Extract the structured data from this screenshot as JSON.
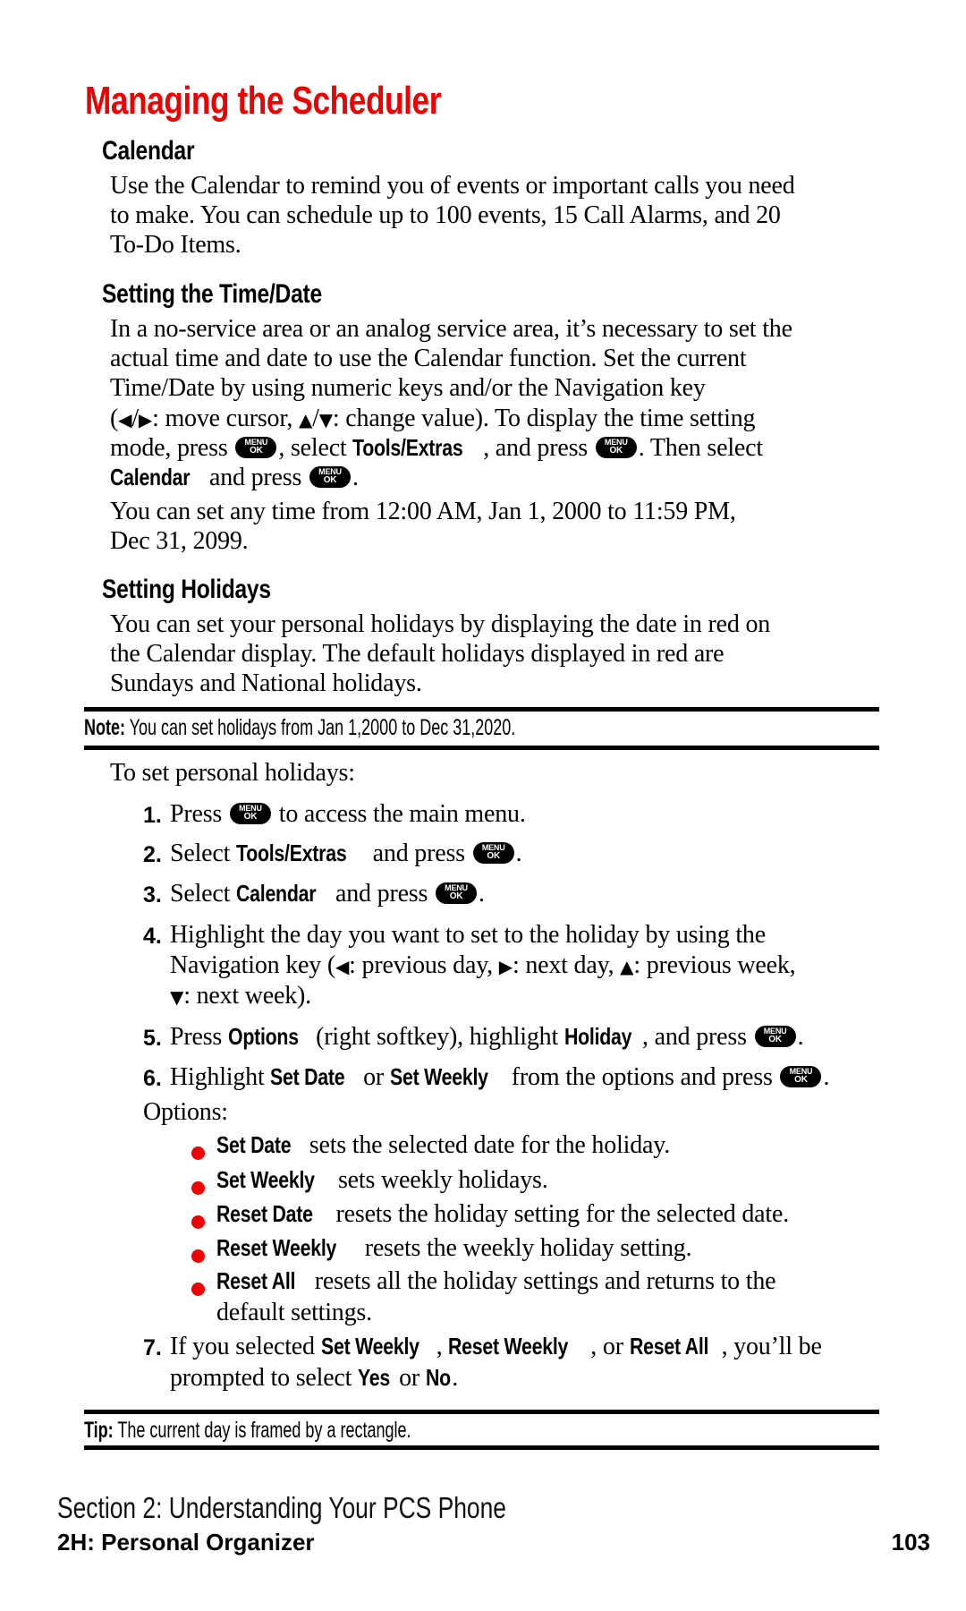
{
  "page": {
    "title": "Managing the Scheduler",
    "accent_color": "#ee0000"
  },
  "key_icon": {
    "line1": "MENU",
    "line2": "OK"
  },
  "calendar": {
    "heading": "Calendar",
    "lines": [
      "Use the Calendar to remind you of events or important calls you need",
      "to make. You can schedule up to 100 events, 15 Call Alarms, and 20",
      "To-Do Items."
    ]
  },
  "time_date": {
    "heading": "Setting the Time/Date",
    "line1": "In a no-service area or an analog service area, it’s necessary to set the",
    "line2": "actual time and date to use the Calendar function. Set the current",
    "line3": "Time/Date by using numeric keys and/or the Navigation key",
    "line4": {
      "open": "(",
      "left_arrow": "◀",
      "slash1": "/",
      "right_arrow": "▶",
      "t1": ": move cursor, ",
      "up_arrow": "▲",
      "slash2": "/",
      "down_arrow": "▼",
      "t2": ": change value). To display the time setting"
    },
    "line5": {
      "t1": "mode, press",
      "t2": ", select ",
      "b1": "Tools/Extras",
      "t3": ", and press",
      "t4": ". Then select"
    },
    "line6": {
      "b1": "Calendar",
      "t1": " and press",
      "t2": "."
    },
    "range_lines": [
      "You can set any time from 12:00 AM, Jan 1, 2000 to 11:59 PM,",
      "Dec 31, 2099."
    ]
  },
  "holidays": {
    "heading": "Setting Holidays",
    "lines": [
      "You can set your personal holidays by displaying the date in red on",
      "the Calendar display. The default holidays displayed in red are",
      "Sundays and National holidays."
    ],
    "note_label": "Note:",
    "note_text": " You can set holidays from Jan 1,2000 to Dec 31,2020.",
    "intro": "To set personal holidays:",
    "steps": [
      {
        "num": "1.",
        "t1": "Press",
        "t2": " to access the main menu."
      },
      {
        "num": "2.",
        "t1": "Select ",
        "b1": "Tools/Extras",
        "t2": " and press",
        "t3": "."
      },
      {
        "num": "3.",
        "t1": "Select ",
        "b1": "Calendar",
        "t2": " and press",
        "t3": "."
      },
      {
        "num": "4.",
        "l1": "Highlight the day you want to set to the holiday by using the",
        "l2a": "Navigation key (",
        "left_arrow": "◀",
        "l2b": ": previous day, ",
        "right_arrow": "▶",
        "l2c": ": next day, ",
        "up_arrow": "▲",
        "l2d": ": previous week,",
        "down_arrow": "▼",
        "l3": ": next week)."
      },
      {
        "num": "5.",
        "t1": "Press ",
        "b1": "Options",
        "t2": " (right softkey), highlight ",
        "b2": "Holiday",
        "t3": ", and press",
        "t4": "."
      },
      {
        "num": "6.",
        "t1": "Highlight ",
        "b1": "Set Date",
        "t2": " or ",
        "b2": "Set Weekly",
        "t3": " from the options and press",
        "t4": "."
      },
      {
        "num": "7.",
        "t1": "If you selected ",
        "b1": "Set Weekly",
        "t2": ", ",
        "b2": "Reset Weekly",
        "t3": ", or ",
        "b3": "Reset All",
        "t4": ", you’ll be",
        "l2a": "prompted to select ",
        "b4": "Yes",
        "l2b": " or ",
        "b5": "No",
        "l2c": "."
      }
    ],
    "options_label": "Options:",
    "options": [
      {
        "name": "Set Date",
        "desc": " sets the selected date for the holiday."
      },
      {
        "name": "Set Weekly",
        "desc": " sets weekly holidays."
      },
      {
        "name": "Reset Date",
        "desc": " resets the holiday setting for the selected date."
      },
      {
        "name": "Reset Weekly",
        "desc": " resets the weekly holiday setting."
      },
      {
        "name": "Reset All",
        "desc": " resets all the holiday settings and returns to the",
        "desc2": "default settings."
      }
    ],
    "tip_label": "Tip:",
    "tip_text": " The current day is framed by a rectangle."
  },
  "footer": {
    "section": "Section 2: Understanding Your PCS Phone",
    "chapter": "2H: Personal Organizer",
    "page_number": "103"
  }
}
